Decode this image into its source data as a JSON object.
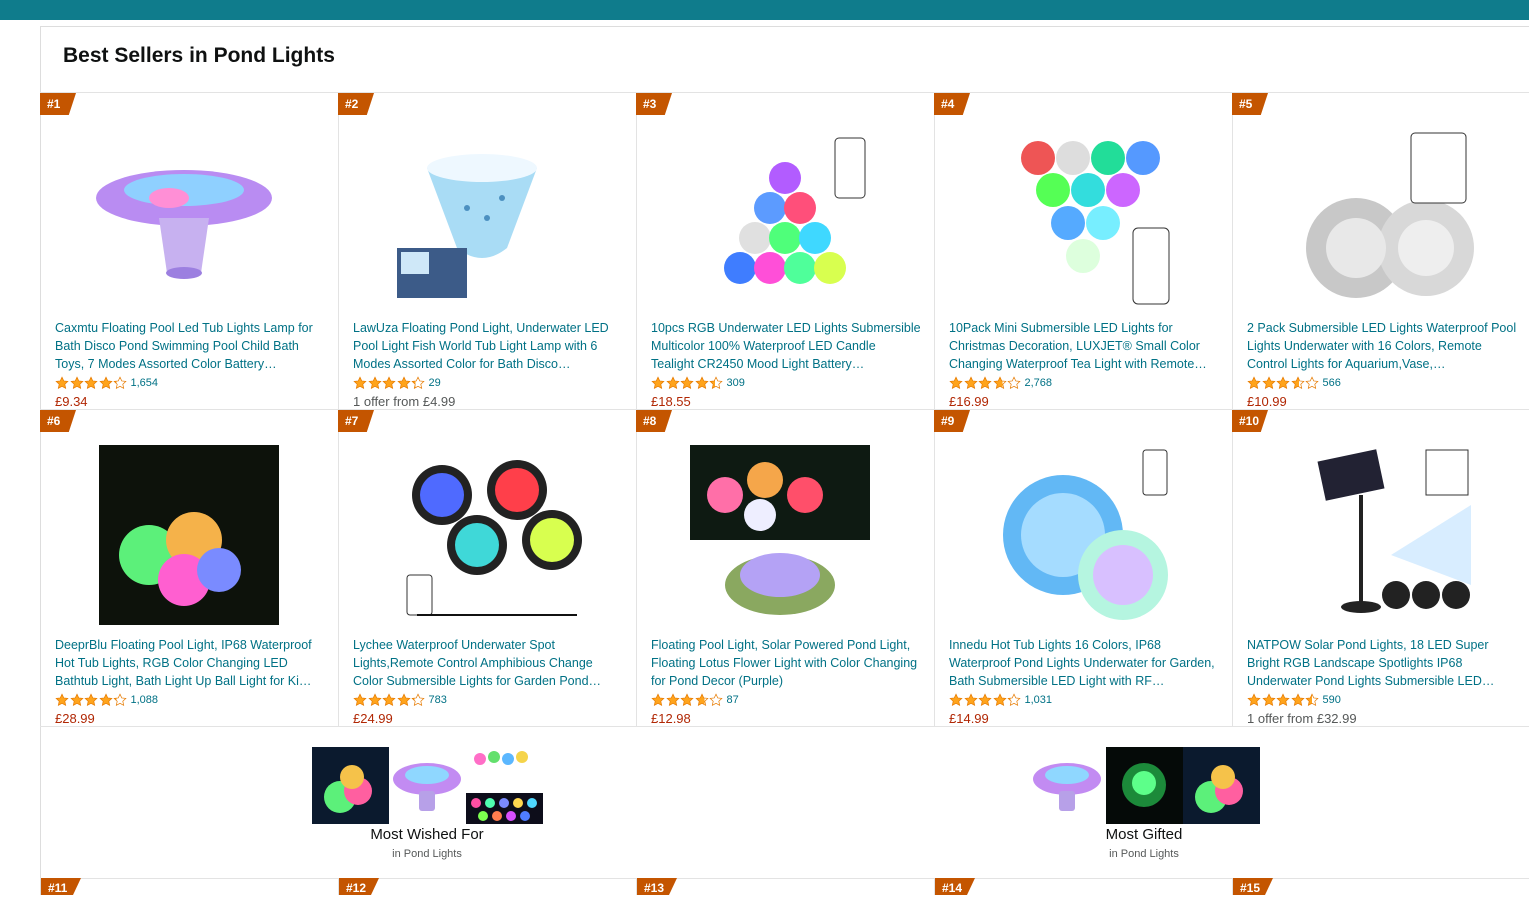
{
  "page": {
    "title": "Best Sellers in Pond Lights"
  },
  "colors": {
    "topbar": "#0f7c8c",
    "rank_badge": "#c45500",
    "link": "#007185",
    "price": "#b12704",
    "star": "#ffa41c"
  },
  "products": [
    {
      "rank": "#1",
      "title": "Caxmtu Floating Pool Led Tub Lights Lamp for Bath Disco Pond Swimming Pool Child Bath Toys, 7 Modes Assorted Color Battery…",
      "rating": 4.2,
      "reviews": "1,654",
      "price": "£9.34",
      "offer": ""
    },
    {
      "rank": "#2",
      "title": "LawUza Floating Pond Light, Underwater LED Pool Light Fish World Tub Light Lamp with 6 Modes Assorted Color for Bath Disco…",
      "rating": 4.3,
      "reviews": "29",
      "price": "",
      "offer": "1 offer from £4.99"
    },
    {
      "rank": "#3",
      "title": "10pcs RGB Underwater LED Lights Submersible Multicolor 100% Waterproof LED Candle Tealight CR2450 Mood Light Battery…",
      "rating": 4.4,
      "reviews": "309",
      "price": "£18.55",
      "offer": ""
    },
    {
      "rank": "#4",
      "title": "10Pack Mini Submersible LED Lights for Christmas Decoration, LUXJET® Small Color Changing Waterproof Tea Light with Remote…",
      "rating": 3.7,
      "reviews": "2,768",
      "price": "£16.99",
      "offer": ""
    },
    {
      "rank": "#5",
      "title": "2 Pack Submersible LED Lights Waterproof Pool Lights Underwater with 16 Colors, Remote Control Lights for Aquarium,Vase,…",
      "rating": 3.6,
      "reviews": "566",
      "price": "£10.99",
      "offer": ""
    },
    {
      "rank": "#6",
      "title": "DeeprBlu Floating Pool Light, IP68 Waterproof Hot Tub Lights, RGB Color Changing LED Bathtub Light, Bath Light Up Ball Light for Ki…",
      "rating": 4.2,
      "reviews": "1,088",
      "price": "£28.99",
      "offer": ""
    },
    {
      "rank": "#7",
      "title": "Lychee Waterproof Underwater Spot Lights,Remote Control Amphibious Change Color Submersible Lights for Garden Pond…",
      "rating": 4.2,
      "reviews": "783",
      "price": "£24.99",
      "offer": ""
    },
    {
      "rank": "#8",
      "title": "Floating Pool Light, Solar Powered Pond Light, Floating Lotus Flower Light with Color Changing for Pond Decor (Purple)",
      "rating": 3.7,
      "reviews": "87",
      "price": "£12.98",
      "offer": ""
    },
    {
      "rank": "#9",
      "title": "Innedu Hot Tub Lights 16 Colors, IP68 Waterproof Pond Lights Underwater for Garden, Bath Submersible LED Light with RF…",
      "rating": 4.2,
      "reviews": "1,031",
      "price": "£14.99",
      "offer": ""
    },
    {
      "rank": "#10",
      "title": "NATPOW Solar Pond Lights, 18 LED Super Bright RGB Landscape Spotlights IP68 Underwater Pond Lights Submersible LED…",
      "rating": 4.5,
      "reviews": "590",
      "price": "",
      "offer": "1 offer from £32.99"
    }
  ],
  "promos": [
    {
      "title": "Most Wished For",
      "subtitle": "in Pond Lights"
    },
    {
      "title": "Most Gifted",
      "subtitle": "in Pond Lights"
    }
  ],
  "next_ranks": [
    "#11",
    "#12",
    "#13",
    "#14",
    "#15"
  ]
}
